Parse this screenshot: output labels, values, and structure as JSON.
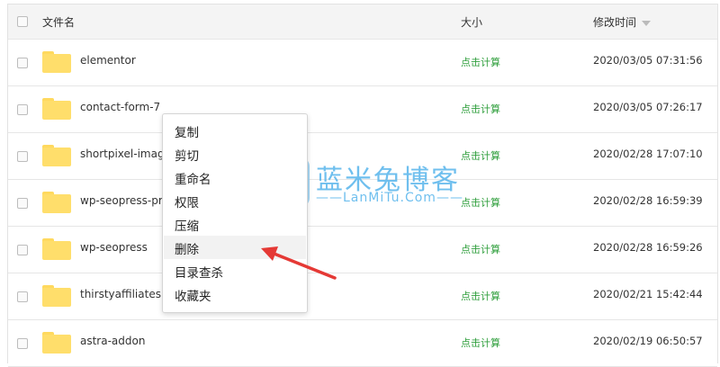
{
  "table": {
    "columns": {
      "name": "文件名",
      "size": "大小",
      "modified": "修改时间"
    },
    "rows": [
      {
        "name": "elementor",
        "size": "点击计算",
        "modified": "2020/03/05 07:31:56"
      },
      {
        "name": "contact-form-7",
        "size": "点击计算",
        "modified": "2020/03/05 07:26:17"
      },
      {
        "name": "shortpixel-imag",
        "size": "点击计算",
        "modified": "2020/02/28 17:07:10"
      },
      {
        "name": "wp-seopress-pr",
        "size": "点击计算",
        "modified": "2020/02/28 16:59:39"
      },
      {
        "name": "wp-seopress",
        "size": "点击计算",
        "modified": "2020/02/28 16:59:26"
      },
      {
        "name": "thirstyaffiliates",
        "size": "点击计算",
        "modified": "2020/02/21 15:42:44"
      },
      {
        "name": "astra-addon",
        "size": "点击计算",
        "modified": "2020/02/19 06:50:57"
      }
    ]
  },
  "context_menu": {
    "items": [
      "复制",
      "剪切",
      "重命名",
      "权限",
      "压缩",
      "删除",
      "目录查杀",
      "收藏夹"
    ],
    "highlighted": "删除"
  },
  "watermark": {
    "title": "蓝米兔博客",
    "subtitle": "LanMiTu.Com"
  },
  "colors": {
    "size_link": "#2e9e3b",
    "arrow": "#e53935",
    "folder": "#ffde6b"
  },
  "icons": {
    "folder": "folder-icon",
    "sort": "sort-desc-icon",
    "pointer": "red-arrow"
  }
}
